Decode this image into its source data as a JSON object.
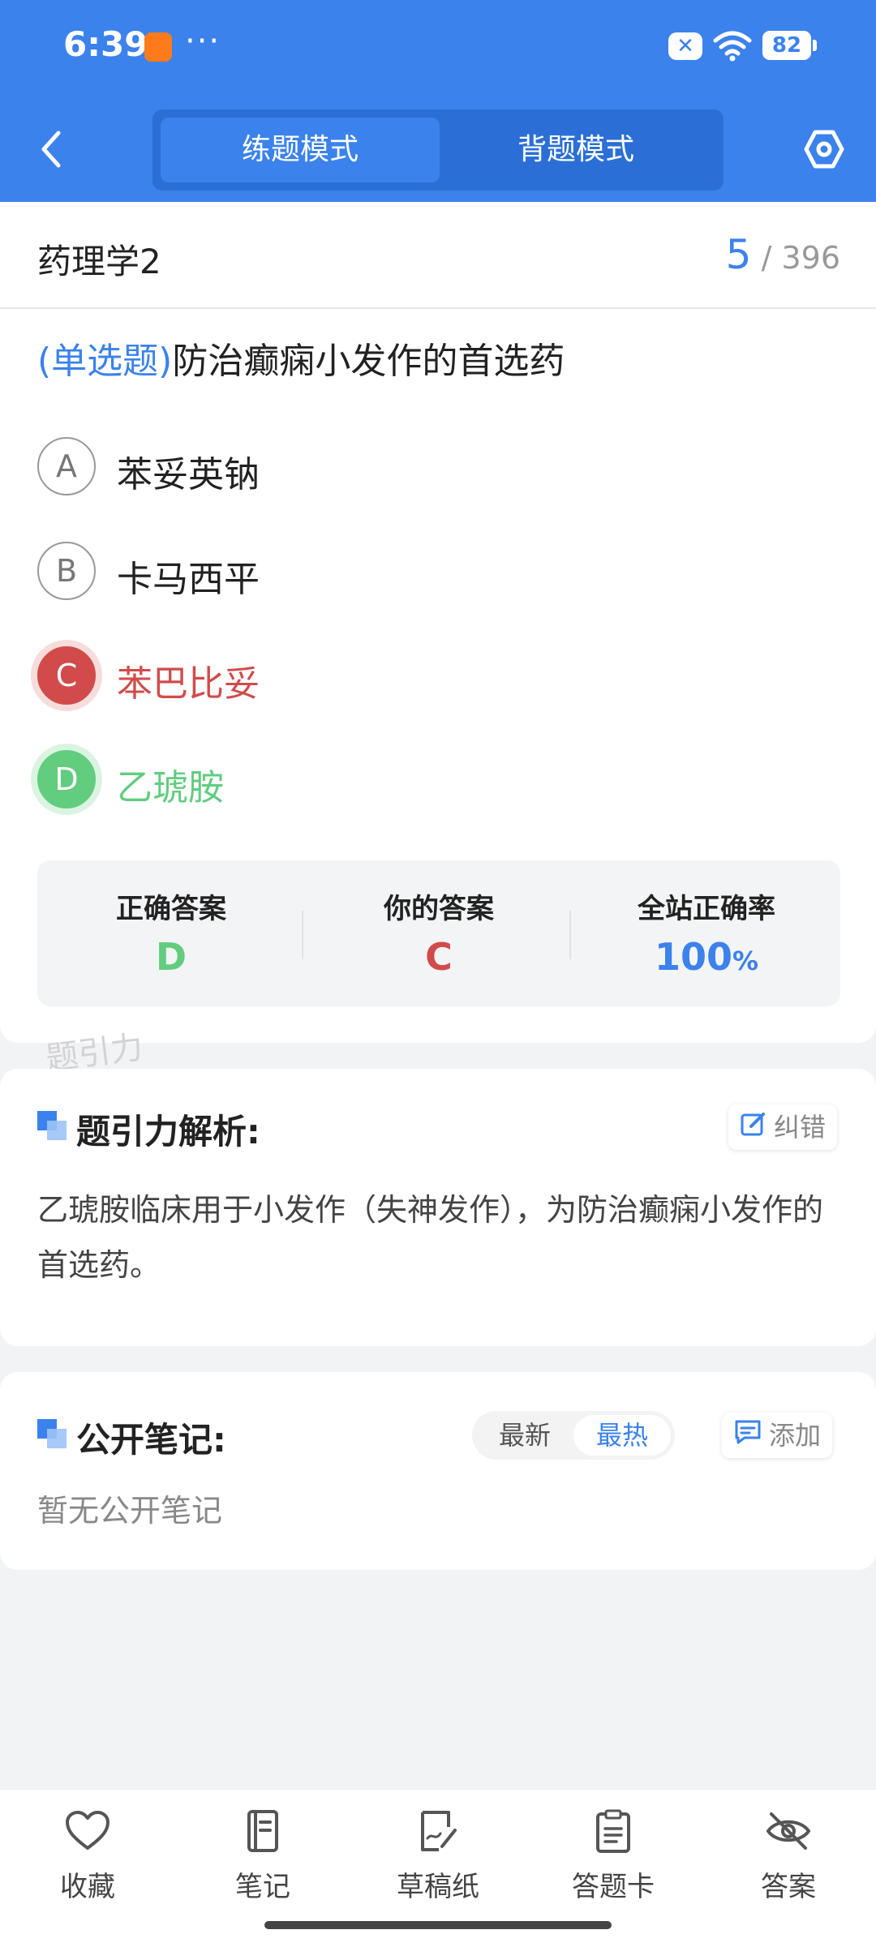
{
  "status_bar": {
    "time": "6:39",
    "more": "···",
    "battery": "82"
  },
  "header": {
    "tabs": [
      {
        "label": "练题模式",
        "active": true
      },
      {
        "label": "背题模式",
        "active": false
      }
    ],
    "icons": {
      "back": "chevron-left-icon",
      "settings": "hexagon-settings-icon"
    }
  },
  "question": {
    "subject": "药理学2",
    "current": "5",
    "total": "/ 396",
    "type": "(单选题)",
    "text": "防治癫痫小发作的首选药",
    "options": [
      {
        "letter": "A",
        "text": "苯妥英钠",
        "state": "normal"
      },
      {
        "letter": "B",
        "text": "卡马西平",
        "state": "normal"
      },
      {
        "letter": "C",
        "text": "苯巴比妥",
        "state": "wrong"
      },
      {
        "letter": "D",
        "text": "乙琥胺",
        "state": "correct"
      }
    ]
  },
  "stats": {
    "correct_label": "正确答案",
    "correct_value": "D",
    "yours_label": "你的答案",
    "yours_value": "C",
    "rate_label": "全站正确率",
    "rate_value": "100",
    "rate_unit": "%"
  },
  "watermark": "题引力",
  "analysis": {
    "title": "题引力解析:",
    "report_label": "纠错",
    "text": "乙琥胺临床用于小发作（失神发作），为防治癫痫小发作的首选药。"
  },
  "notes": {
    "title": "公开笔记:",
    "sort_latest": "最新",
    "sort_hottest": "最热",
    "add_label": "添加",
    "empty_text": "暂无公开笔记"
  },
  "bottom_nav": [
    {
      "label": "收藏",
      "icon": "heart-icon"
    },
    {
      "label": "笔记",
      "icon": "notebook-icon"
    },
    {
      "label": "草稿纸",
      "icon": "draft-icon"
    },
    {
      "label": "答题卡",
      "icon": "clipboard-icon"
    },
    {
      "label": "答案",
      "icon": "eye-off-icon"
    }
  ],
  "colors": {
    "primary": "#3b82ec",
    "correct": "#62cc7f",
    "wrong": "#d14b4b"
  }
}
